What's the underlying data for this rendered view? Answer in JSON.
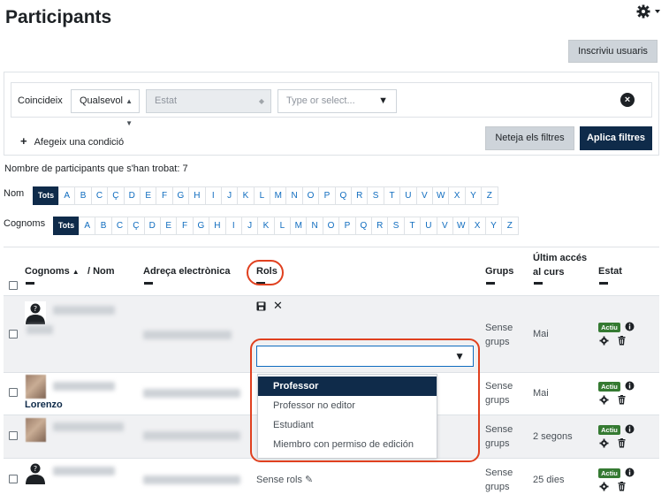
{
  "page": {
    "title": "Participants"
  },
  "actions": {
    "enrol_label": "Inscriviu usuaris"
  },
  "filters": {
    "match_label": "Coincideix",
    "match_value": "Qualsevol",
    "state_value": "Estat",
    "type_placeholder": "Type or select...",
    "add_condition_label": "Afegeix una condició",
    "reset_label": "Neteja els filtres",
    "apply_label": "Aplica filtres"
  },
  "count_text": "Nombre de participants que s'han trobat: 7",
  "initials": {
    "first_label": "Nom",
    "last_label": "Cognoms",
    "all_label": "Tots",
    "letters": [
      "A",
      "B",
      "C",
      "Ç",
      "D",
      "E",
      "F",
      "G",
      "H",
      "I",
      "J",
      "K",
      "L",
      "M",
      "N",
      "O",
      "P",
      "Q",
      "R",
      "S",
      "T",
      "U",
      "V",
      "W",
      "X",
      "Y",
      "Z"
    ]
  },
  "table": {
    "headers": {
      "surname": "Cognoms",
      "name": "/ Nom",
      "email": "Adreça electrònica",
      "roles": "Rols",
      "groups": "Grups",
      "last_access_1": "Últim accés",
      "last_access_2": "al curs",
      "status": "Estat"
    },
    "rows": [
      {
        "name": "",
        "groups": [
          "Sense",
          "grups"
        ],
        "last_access": "Mai",
        "status": "Actiu"
      },
      {
        "name": "Lorenzo",
        "groups": [
          "Sense",
          "grups"
        ],
        "last_access": "Mai",
        "status": "Actiu"
      },
      {
        "name": "",
        "groups": [
          "Sense",
          "grups"
        ],
        "last_access": "2 segons",
        "status": "Actiu"
      },
      {
        "name": "",
        "groups": [
          "Sense",
          "grups"
        ],
        "last_access": "25 dies",
        "status": "Actiu",
        "roles": "Sense rols"
      }
    ]
  },
  "role_dropdown": {
    "options": [
      "Professor",
      "Professor no editor",
      "Estudiant",
      "Miembro con permiso de edición"
    ],
    "selected": "Professor"
  },
  "colors": {
    "primary": "#0f2b4a",
    "link": "#0f6cbf",
    "active_badge": "#357a32",
    "highlight": "#e0401f"
  }
}
